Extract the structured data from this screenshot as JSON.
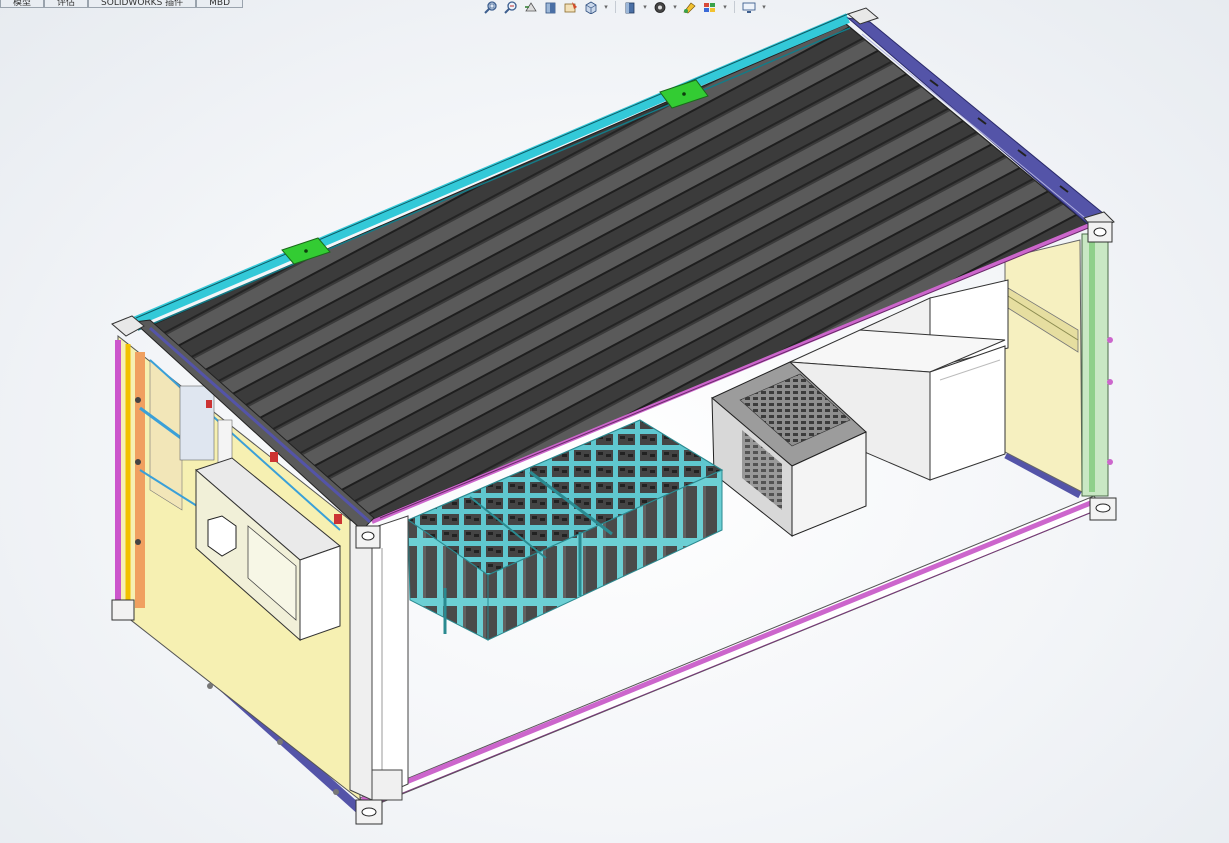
{
  "window": {
    "type": "CAD model viewport"
  },
  "tabs": [
    {
      "label": "模型"
    },
    {
      "label": "评估"
    },
    {
      "label": "SOLIDWORKS 插件"
    },
    {
      "label": "MBD"
    }
  ],
  "heads_up_toolbar": [
    {
      "icon": "zoom-to-fit-icon",
      "has_dropdown": false
    },
    {
      "icon": "zoom-to-area-icon",
      "has_dropdown": false
    },
    {
      "icon": "previous-view-icon",
      "has_dropdown": false
    },
    {
      "icon": "section-view-icon",
      "has_dropdown": false
    },
    {
      "icon": "dynamic-annotation-views-icon",
      "has_dropdown": false
    },
    {
      "icon": "view-orientation-icon",
      "has_dropdown": true
    },
    {
      "icon": "display-style-icon",
      "has_dropdown": true
    },
    {
      "icon": "hide-show-items-icon",
      "has_dropdown": true
    },
    {
      "icon": "edit-appearance-icon",
      "has_dropdown": false
    },
    {
      "icon": "apply-scene-icon",
      "has_dropdown": true
    },
    {
      "icon": "view-settings-icon",
      "has_dropdown": true
    }
  ],
  "colors": {
    "roof_dark": "#3a3a3a",
    "roof_light": "#5c5c5c",
    "top_rail_cyan": "#33c9d8",
    "side_rail_navy": "#5454a8",
    "bottom_rail_magenta": "#cc66cc",
    "end_wall_yellow": "#f6f0b2",
    "battery_rack_cyan": "#6fd0d4",
    "battery_dark": "#4a4a4a",
    "cabinet_white": "#f5f5f5",
    "air_conditioner_light": "#f1f0d8",
    "green_lifting_plate": "#33cc33",
    "corner_casting_white": "#e8e8e8"
  }
}
